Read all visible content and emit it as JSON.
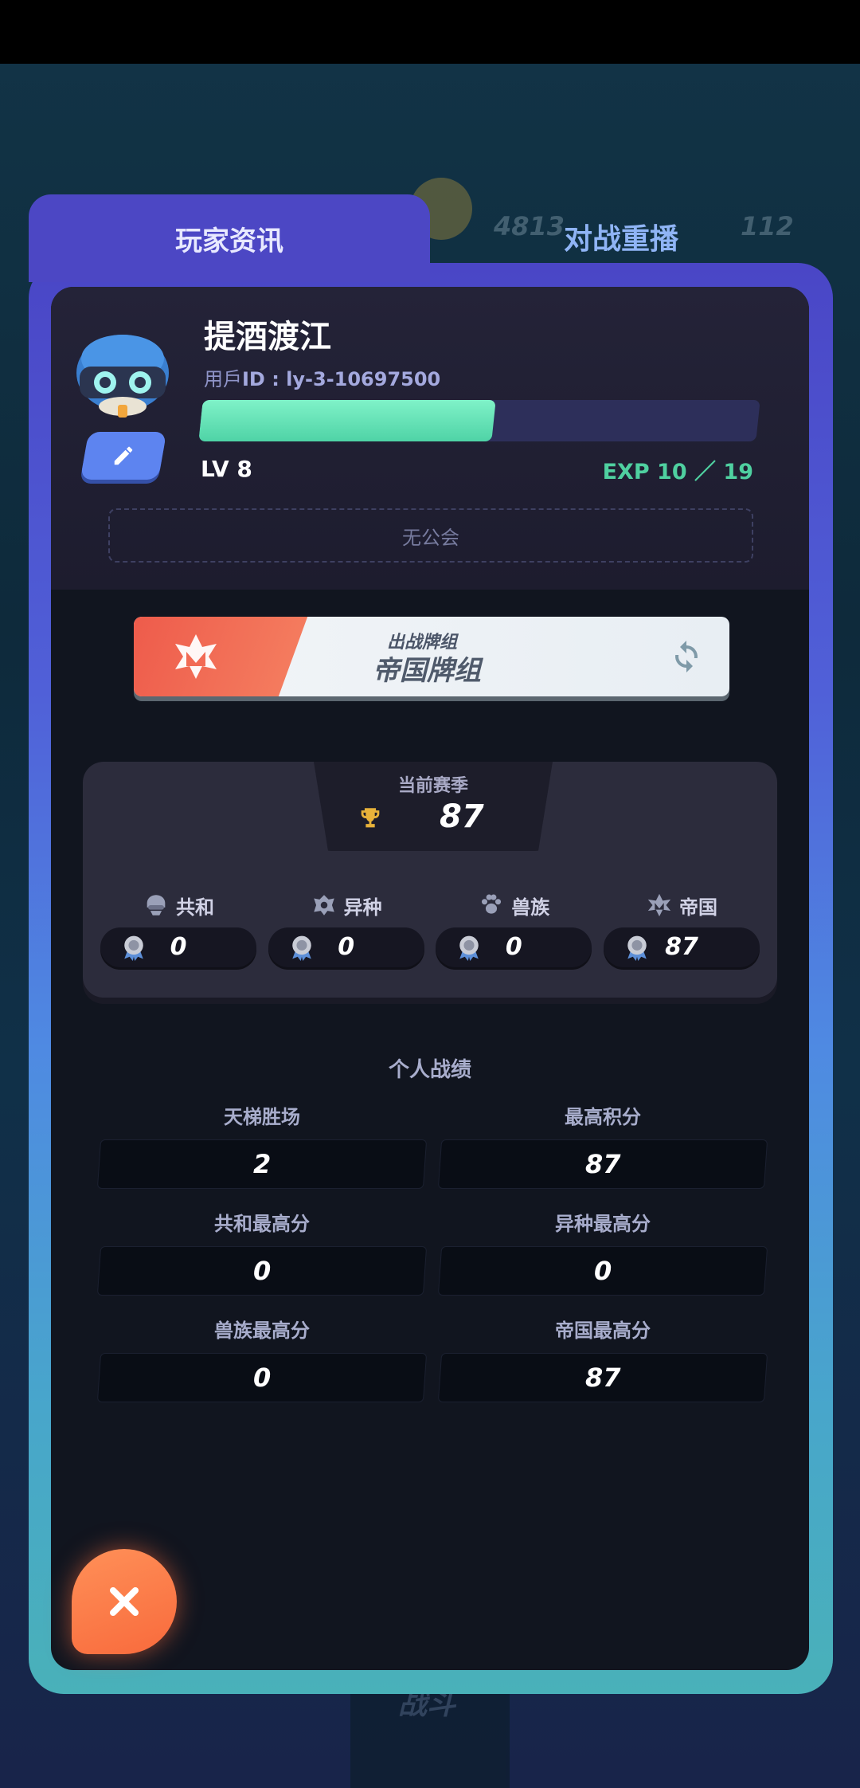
{
  "background_hud": {
    "coins": "4813",
    "gems": "112",
    "bottom_label": "战斗"
  },
  "tabs": [
    {
      "label": "玩家资讯",
      "active": true
    },
    {
      "label": "对战重播",
      "active": false
    }
  ],
  "profile": {
    "name": "提酒渡江",
    "uid_prefix": "用戶",
    "uid": "ID : ly-3-10697500",
    "level": "LV 8",
    "exp_text": "EXP 10 ／ 19",
    "exp_current": 10,
    "exp_max": 19,
    "guild": "无公会",
    "avatar_icon": "helmet-avatar-icon",
    "edit_icon": "pencil-icon"
  },
  "deck": {
    "sub_label": "出战牌组",
    "name": "帝国牌组",
    "icon": "empire-emblem-icon",
    "refresh_icon": "refresh-icon"
  },
  "season": {
    "title": "当前赛季",
    "score": "87",
    "factions": [
      {
        "name": "共和",
        "icon": "republic-icon",
        "value": "0"
      },
      {
        "name": "异种",
        "icon": "xeno-icon",
        "value": "0"
      },
      {
        "name": "兽族",
        "icon": "beast-paw-icon",
        "value": "0"
      },
      {
        "name": "帝国",
        "icon": "empire-icon",
        "value": "87"
      }
    ]
  },
  "stats": {
    "title": "个人战绩",
    "items": [
      {
        "label": "天梯胜场",
        "value": "2"
      },
      {
        "label": "最高积分",
        "value": "87"
      },
      {
        "label": "共和最高分",
        "value": "0"
      },
      {
        "label": "异种最高分",
        "value": "0"
      },
      {
        "label": "兽族最高分",
        "value": "0"
      },
      {
        "label": "帝国最高分",
        "value": "87"
      }
    ]
  },
  "colors": {
    "accent": "#4c47c4",
    "exp": "#4fd0a0",
    "close": "#f86a3c"
  }
}
